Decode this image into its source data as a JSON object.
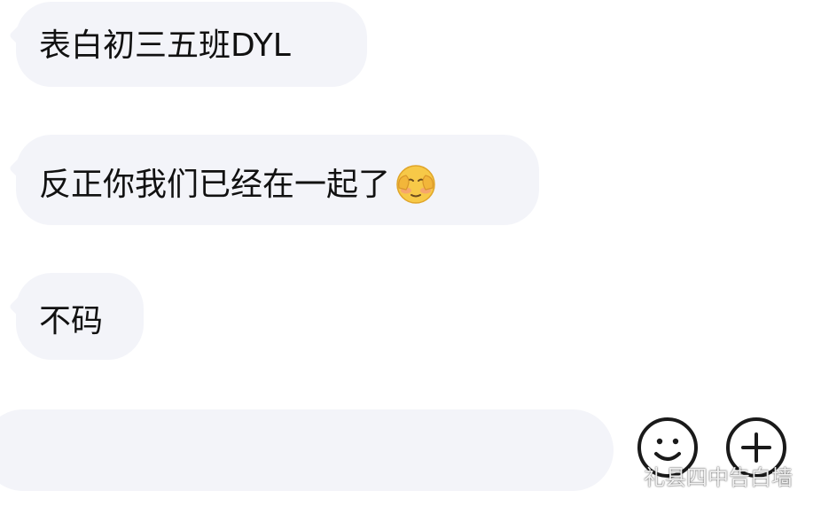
{
  "messages": [
    {
      "text": "表白初三五班DYL"
    },
    {
      "text": "反正你我们已经在一起了",
      "emoji": "shy-face-emoji"
    },
    {
      "text": "不码"
    }
  ],
  "input": {
    "value": "",
    "placeholder": ""
  },
  "buttons": {
    "emoji_icon": "smiley-face-icon",
    "plus_icon": "plus-icon"
  },
  "watermark": {
    "text": "礼县四中告白墙",
    "icon": "wechat-icon"
  },
  "colors": {
    "bubble": "#f3f4f9",
    "text": "#111111",
    "icon_stroke": "#1a1a1a",
    "emoji_yellow": "#f7c948"
  }
}
